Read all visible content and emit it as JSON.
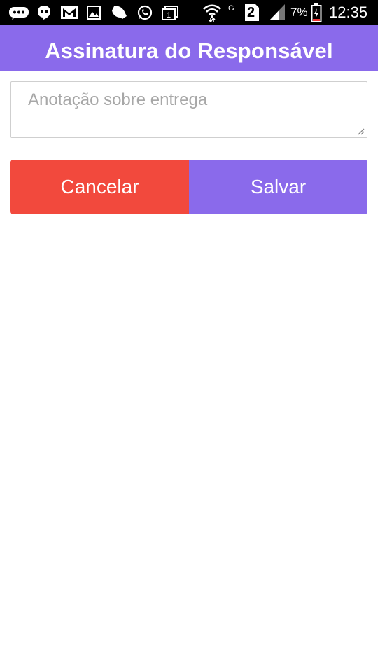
{
  "status_bar": {
    "icons": [
      "messenger-icon",
      "hangouts-icon",
      "gmail-icon",
      "gallery-icon",
      "bell-app-icon",
      "whatsapp-icon",
      "calendar-icon",
      "wifi-icon",
      "sim-2-icon",
      "signal-icon",
      "battery-icon"
    ],
    "network_letter": "G",
    "sim_label": "2",
    "battery_percent": "7%",
    "calendar_day": "1",
    "time": "12:35"
  },
  "header": {
    "title": "Assinatura do Responsável",
    "color": "#8a6aeb"
  },
  "note_field": {
    "value": "",
    "placeholder": "Anotação sobre entrega"
  },
  "actions": {
    "cancel_label": "Cancelar",
    "cancel_color": "#f2493d",
    "save_label": "Salvar",
    "save_color": "#8a6aeb"
  }
}
